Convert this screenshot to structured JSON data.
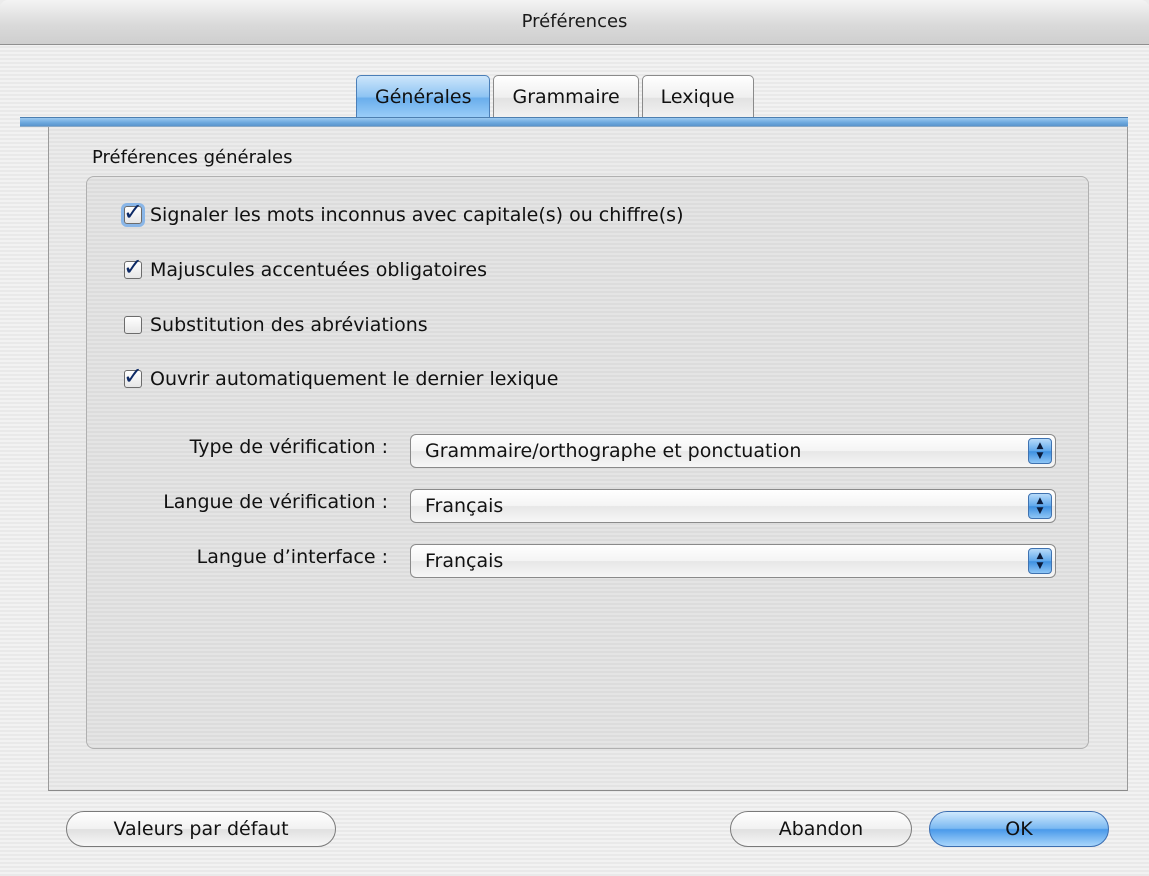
{
  "window": {
    "title": "Préférences"
  },
  "tabs": [
    {
      "label": "Générales",
      "active": true
    },
    {
      "label": "Grammaire",
      "active": false
    },
    {
      "label": "Lexique",
      "active": false
    }
  ],
  "group": {
    "title": "Préférences générales"
  },
  "options": [
    {
      "label": "Signaler les mots inconnus avec capitale(s) ou chiffre(s)",
      "checked": true
    },
    {
      "label": "Majuscules accentuées obligatoires",
      "checked": true
    },
    {
      "label": "Substitution des abréviations",
      "checked": false
    },
    {
      "label": "Ouvrir automatiquement le dernier lexique",
      "checked": true
    }
  ],
  "selects": [
    {
      "label": "Type de vérification :",
      "value": "Grammaire/orthographe et ponctuation"
    },
    {
      "label": "Langue de vérification :",
      "value": "Français"
    },
    {
      "label": "Langue d’interface :",
      "value": "Français"
    }
  ],
  "buttons": {
    "defaults": "Valeurs par défaut",
    "cancel": "Abandon",
    "ok": "OK"
  },
  "colors": {
    "accent": "#6aaeec",
    "check": "#0d2a66"
  }
}
